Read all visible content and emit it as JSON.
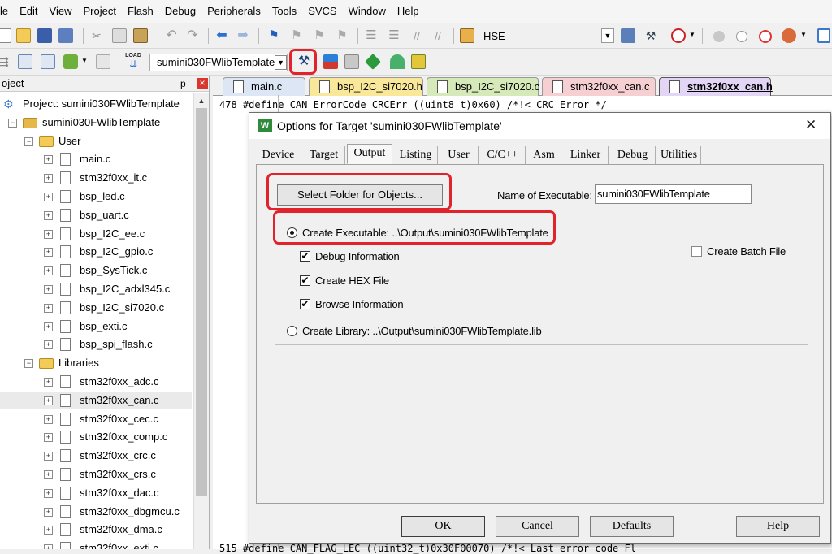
{
  "menu": [
    "le",
    "Edit",
    "View",
    "Project",
    "Flash",
    "Debug",
    "Peripherals",
    "Tools",
    "SVCS",
    "Window",
    "Help"
  ],
  "toolbar1": {
    "hse_label": "HSE"
  },
  "toolbar2": {
    "target_select": "sumini030FWlibTemplate",
    "load_label": "LOAD"
  },
  "project_panel": {
    "title": "oject",
    "pin": "ᵽ",
    "close": "×",
    "tree": [
      {
        "label": "Project: sumini030FWlibTemplate",
        "level": 0,
        "type": "project"
      },
      {
        "label": "sumini030FWlibTemplate",
        "level": 1,
        "type": "target"
      },
      {
        "label": "User",
        "level": 2,
        "type": "folder"
      },
      {
        "label": "main.c",
        "level": 3,
        "type": "file"
      },
      {
        "label": "stm32f0xx_it.c",
        "level": 3,
        "type": "file"
      },
      {
        "label": "bsp_led.c",
        "level": 3,
        "type": "file"
      },
      {
        "label": "bsp_uart.c",
        "level": 3,
        "type": "file"
      },
      {
        "label": "bsp_I2C_ee.c",
        "level": 3,
        "type": "file"
      },
      {
        "label": "bsp_I2C_gpio.c",
        "level": 3,
        "type": "file"
      },
      {
        "label": "bsp_SysTick.c",
        "level": 3,
        "type": "file"
      },
      {
        "label": "bsp_I2C_adxl345.c",
        "level": 3,
        "type": "file"
      },
      {
        "label": "bsp_I2C_si7020.c",
        "level": 3,
        "type": "file"
      },
      {
        "label": "bsp_exti.c",
        "level": 3,
        "type": "file"
      },
      {
        "label": "bsp_spi_flash.c",
        "level": 3,
        "type": "file"
      },
      {
        "label": "Libraries",
        "level": 2,
        "type": "folder"
      },
      {
        "label": "stm32f0xx_adc.c",
        "level": 3,
        "type": "file"
      },
      {
        "label": "stm32f0xx_can.c",
        "level": 3,
        "type": "file",
        "selected": true
      },
      {
        "label": "stm32f0xx_cec.c",
        "level": 3,
        "type": "file"
      },
      {
        "label": "stm32f0xx_comp.c",
        "level": 3,
        "type": "file"
      },
      {
        "label": "stm32f0xx_crc.c",
        "level": 3,
        "type": "file"
      },
      {
        "label": "stm32f0xx_crs.c",
        "level": 3,
        "type": "file"
      },
      {
        "label": "stm32f0xx_dac.c",
        "level": 3,
        "type": "file"
      },
      {
        "label": "stm32f0xx_dbgmcu.c",
        "level": 3,
        "type": "file"
      },
      {
        "label": "stm32f0xx_dma.c",
        "level": 3,
        "type": "file"
      },
      {
        "label": "stm32f0xx_exti.c",
        "level": 3,
        "type": "file"
      }
    ]
  },
  "editor": {
    "tabs": [
      {
        "label": "main.c",
        "color": "#dce6f4"
      },
      {
        "label": "bsp_I2C_si7020.h",
        "color": "#f9e79a"
      },
      {
        "label": "bsp_I2C_si7020.c",
        "color": "#d6e9b8"
      },
      {
        "label": "stm32f0xx_can.c",
        "color": "#f6cfd3"
      },
      {
        "label": "stm32f0xx_can.h",
        "color": "#e2d5f5",
        "active": true
      }
    ],
    "line_top": "478  #define CAN_ErrorCode_CRCErr            ((uint8_t)0x60) /*!< CRC Error  */",
    "line_bottom": "515  #define CAN_FLAG_LEC                   ((uint32_t)0x30F00070) /*!< Last error code Fl"
  },
  "dialog": {
    "title": "Options for Target 'sumini030FWlibTemplate'",
    "close": "✕",
    "tabs": [
      "Device",
      "Target",
      "Output",
      "Listing",
      "User",
      "C/C++",
      "Asm",
      "Linker",
      "Debug",
      "Utilities"
    ],
    "active_tab": "Output",
    "select_folder_button": "Select Folder for Objects...",
    "name_of_executable_label": "Name of Executable:",
    "name_of_executable_value": "sumini030FWlibTemplate",
    "create_executable_label": "Create Executable:  ..\\Output\\sumini030FWlibTemplate",
    "create_executable_selected": true,
    "debug_information": {
      "label": "Debug Information",
      "checked": true
    },
    "create_hex_file": {
      "label": "Create HEX File",
      "checked": true
    },
    "browse_information": {
      "label": "Browse Information",
      "checked": true
    },
    "create_library_label": "Create Library:  ..\\Output\\sumini030FWlibTemplate.lib",
    "create_batch_file": {
      "label": "Create Batch File",
      "checked": false
    },
    "ok": "OK",
    "cancel": "Cancel",
    "defaults": "Defaults",
    "help": "Help"
  },
  "highlight_color": "#e1242c"
}
